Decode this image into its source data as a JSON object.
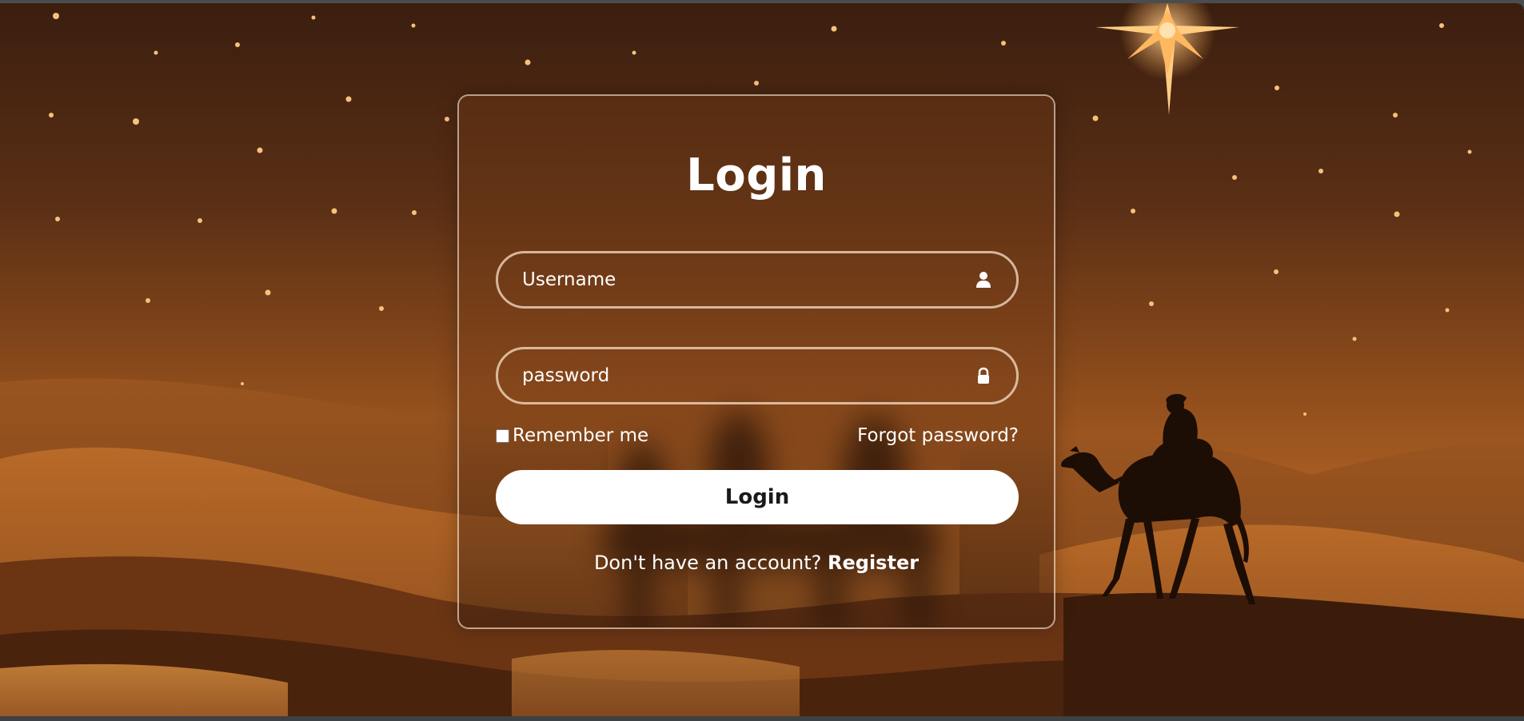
{
  "login_form": {
    "title": "Login",
    "username_placeholder": "Username",
    "password_placeholder": "password",
    "remember_label": "Remember me",
    "forgot_label": "Forgot password?",
    "submit_label": "Login",
    "register_prompt": "Don't have an account?",
    "register_link": "Register"
  },
  "icons": {
    "username": "user-icon",
    "password": "lock-icon"
  },
  "theme": {
    "background": "desert-night-camel",
    "accent": "#ffffff",
    "sky_dark": "#3b1e0f",
    "sand": "#c97a30"
  }
}
